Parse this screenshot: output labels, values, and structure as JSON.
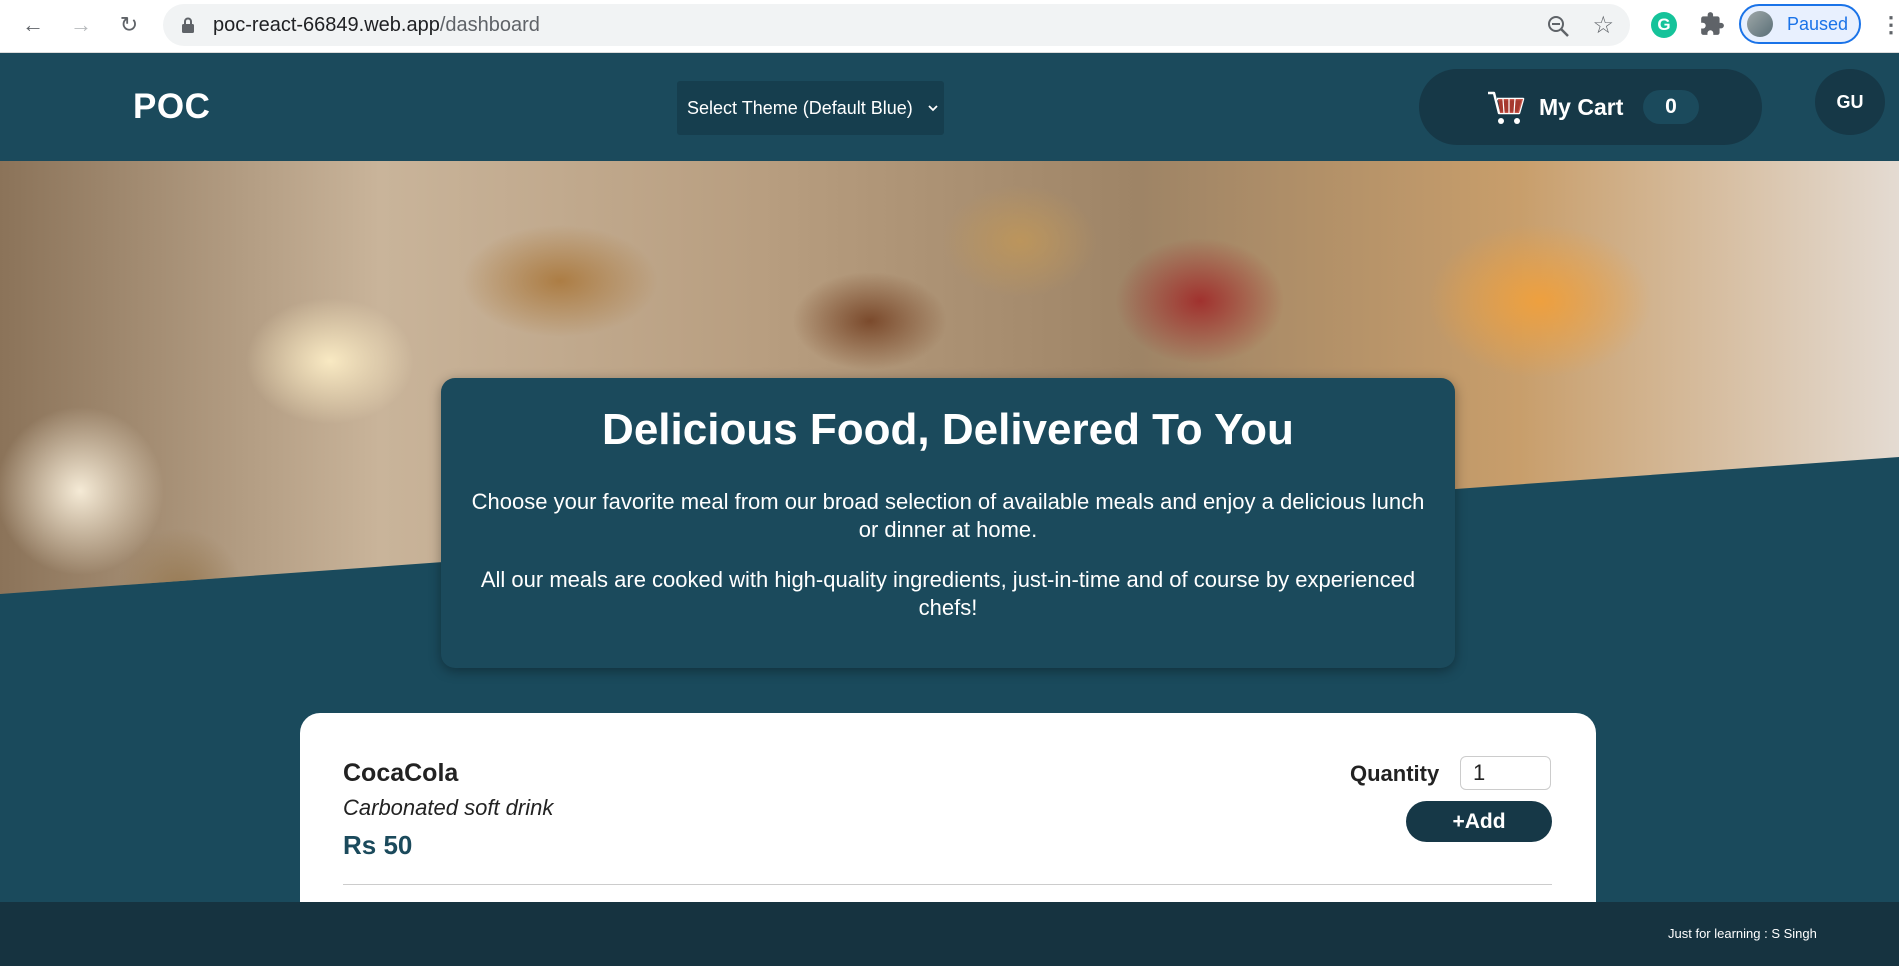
{
  "browser": {
    "url_host": "poc-react-66849.web.app",
    "url_path": "/dashboard",
    "profile_label": "Paused",
    "icons": [
      "back-icon",
      "forward-icon",
      "reload-icon",
      "lock-icon",
      "zoom-icon",
      "star-icon",
      "grammarly-icon",
      "extensions-icon",
      "menu-icon"
    ]
  },
  "header": {
    "logo": "POC",
    "theme_select": "Select Theme (Default Blue)",
    "cart_label": "My Cart",
    "cart_count": "0",
    "user_initials": "GU"
  },
  "intro": {
    "title": "Delicious Food, Delivered To You",
    "paragraph1": "Choose your favorite meal from our broad selection of available meals and enjoy a delicious lunch or dinner at home.",
    "paragraph2": "All our meals are cooked with high-quality ingredients, just-in-time and of course by experienced chefs!"
  },
  "meals": [
    {
      "name": "CocaCola",
      "description": "Carbonated soft drink",
      "price": "Rs 50",
      "quantity_label": "Quantity",
      "quantity_value": "1",
      "add_label": "+Add"
    }
  ],
  "footer": {
    "text": "Just for learning : S Singh"
  },
  "colors": {
    "primary": "#1b4a5c",
    "dark": "#163847",
    "footer": "#163340"
  }
}
